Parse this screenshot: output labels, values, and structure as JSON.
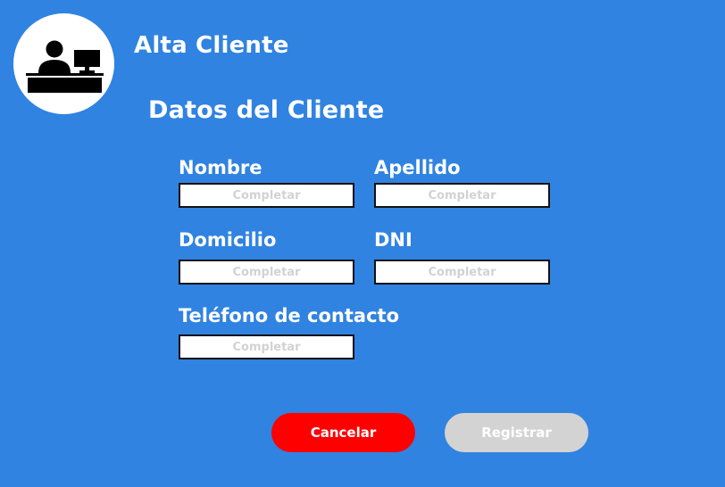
{
  "header": {
    "title": "Alta Cliente",
    "logo_icon": "customer-service-desk-icon"
  },
  "form": {
    "section_title": "Datos del Cliente",
    "fields": {
      "nombre": {
        "label": "Nombre",
        "value": "",
        "placeholder": "Completar"
      },
      "apellido": {
        "label": "Apellido",
        "value": "",
        "placeholder": "Completar"
      },
      "domicilio": {
        "label": "Domicilio",
        "value": "",
        "placeholder": "Completar"
      },
      "dni": {
        "label": "DNI",
        "value": "",
        "placeholder": "Completar"
      },
      "telefono": {
        "label": "Teléfono de contacto",
        "value": "",
        "placeholder": "Completar"
      }
    }
  },
  "actions": {
    "cancel_label": "Cancelar",
    "register_label": "Registrar"
  },
  "colors": {
    "background": "#3083E1",
    "cancel_button": "#FF0000",
    "register_button_disabled": "#D3D3D3",
    "text": "#FFFFFF",
    "placeholder": "#D2D2D2"
  }
}
